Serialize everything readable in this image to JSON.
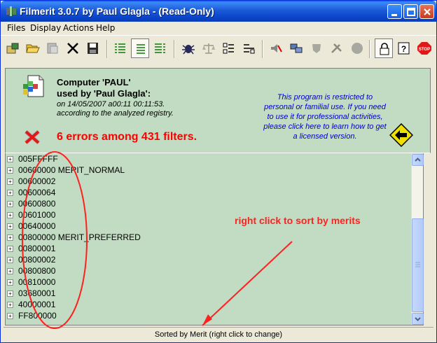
{
  "window": {
    "title": "Filmerit 3.0.7 by Paul Glagla - (Read-Only)"
  },
  "menu": [
    "Files",
    "Display",
    "Actions",
    "Help"
  ],
  "info": {
    "computer_line": "Computer 'PAUL'",
    "used_by_line": "used by 'Paul Glagla':",
    "date_line": "on 14/05/2007 a00:11 00:11:53.",
    "registry_line": "according to the analyzed registry.",
    "errors_line": "6 errors among 431 filters.",
    "license_lines": [
      "This program is restricted to",
      "personal or familial use.  If you need",
      "to use it for professional activities,",
      "please click here to learn how to get",
      "a licensed version."
    ]
  },
  "tree": {
    "rows": [
      "005FFFFF",
      "00600000 MERIT_NORMAL",
      "00600002",
      "00600064",
      "00600800",
      "00601000",
      "00640000",
      "00800000 MERIT_PREFERRED",
      "00800001",
      "00800002",
      "00800800",
      "00810000",
      "03680001",
      "40000001",
      "FF800000"
    ]
  },
  "annotation": {
    "text": "right click to sort by merits",
    "color": "#ff2020"
  },
  "status": {
    "text": "Sorted by Merit (right click to change)"
  },
  "colors": {
    "panel_bg": "#c1dcc2",
    "error_red": "#ff0000",
    "license_blue": "#0000c8"
  }
}
